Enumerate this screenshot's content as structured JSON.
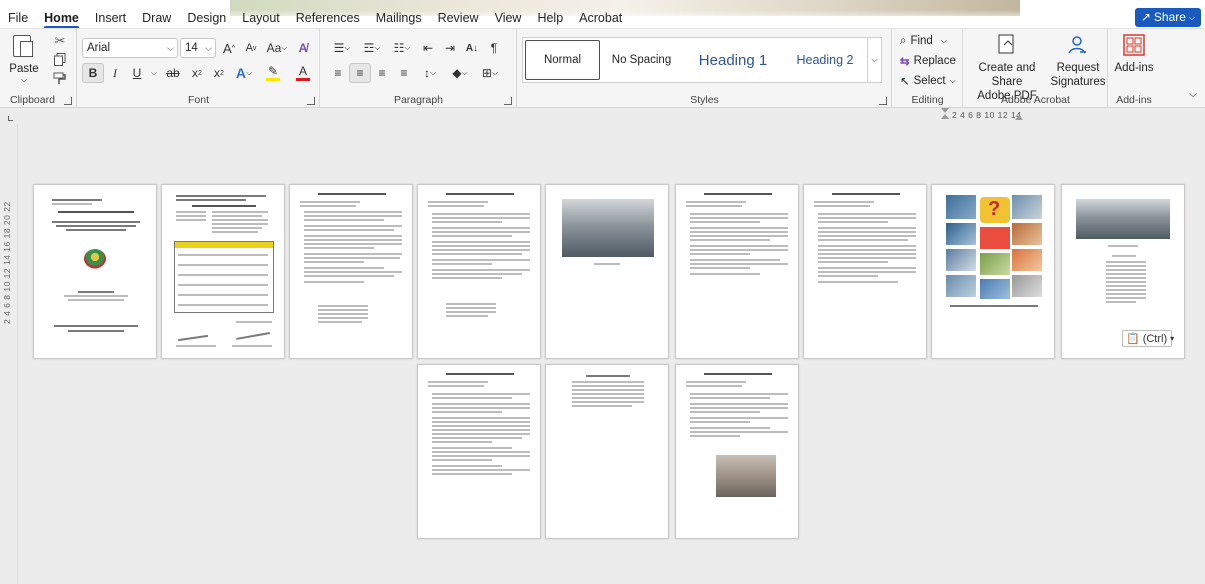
{
  "menu": {
    "tabs": [
      "File",
      "Home",
      "Insert",
      "Draw",
      "Design",
      "Layout",
      "References",
      "Mailings",
      "Review",
      "View",
      "Help",
      "Acrobat"
    ],
    "active_tab": "Home",
    "share_label": "Share"
  },
  "ribbon": {
    "clipboard": {
      "paste_label": "Paste",
      "group_label": "Clipboard"
    },
    "font": {
      "font_name": "Arial",
      "font_size": "14",
      "grow_label": "A",
      "shrink_label": "A",
      "case_label": "Aa",
      "bold": "B",
      "italic": "I",
      "underline": "U",
      "strike": "ab",
      "subscript": "x",
      "superscript": "x",
      "effects_label": "A",
      "highlight_color": "#ffe600",
      "font_color_label": "A",
      "font_color": "#e01a1a",
      "group_label": "Font"
    },
    "paragraph": {
      "group_label": "Paragraph",
      "sort_icon": "sort-icon",
      "pilcrow": "¶"
    },
    "styles": {
      "items": [
        {
          "label": "Normal",
          "selected": true
        },
        {
          "label": "No Spacing",
          "selected": false
        },
        {
          "label": "Heading 1",
          "selected": false
        },
        {
          "label": "Heading 2",
          "selected": false
        }
      ],
      "group_label": "Styles"
    },
    "editing": {
      "find_label": "Find",
      "replace_label": "Replace",
      "select_label": "Select",
      "group_label": "Editing"
    },
    "acrobat": {
      "create_share_label_1": "Create and Share",
      "create_share_label_2": "Adobe PDF",
      "request_sig_label_1": "Request",
      "request_sig_label_2": "Signatures",
      "group_label": "Adobe Acrobat"
    },
    "addins": {
      "label": "Add-ins",
      "group_label": "Add-ins"
    }
  },
  "ruler": {
    "numbers": "2  4  6  8  10  12  14"
  },
  "vruler": {
    "numbers": "2  4  6  8  10  12  14  16  18  20  22"
  },
  "paste_options": {
    "label": "(Ctrl)"
  },
  "colors": {
    "accent": "#185abd",
    "heading": "#2f5496"
  }
}
